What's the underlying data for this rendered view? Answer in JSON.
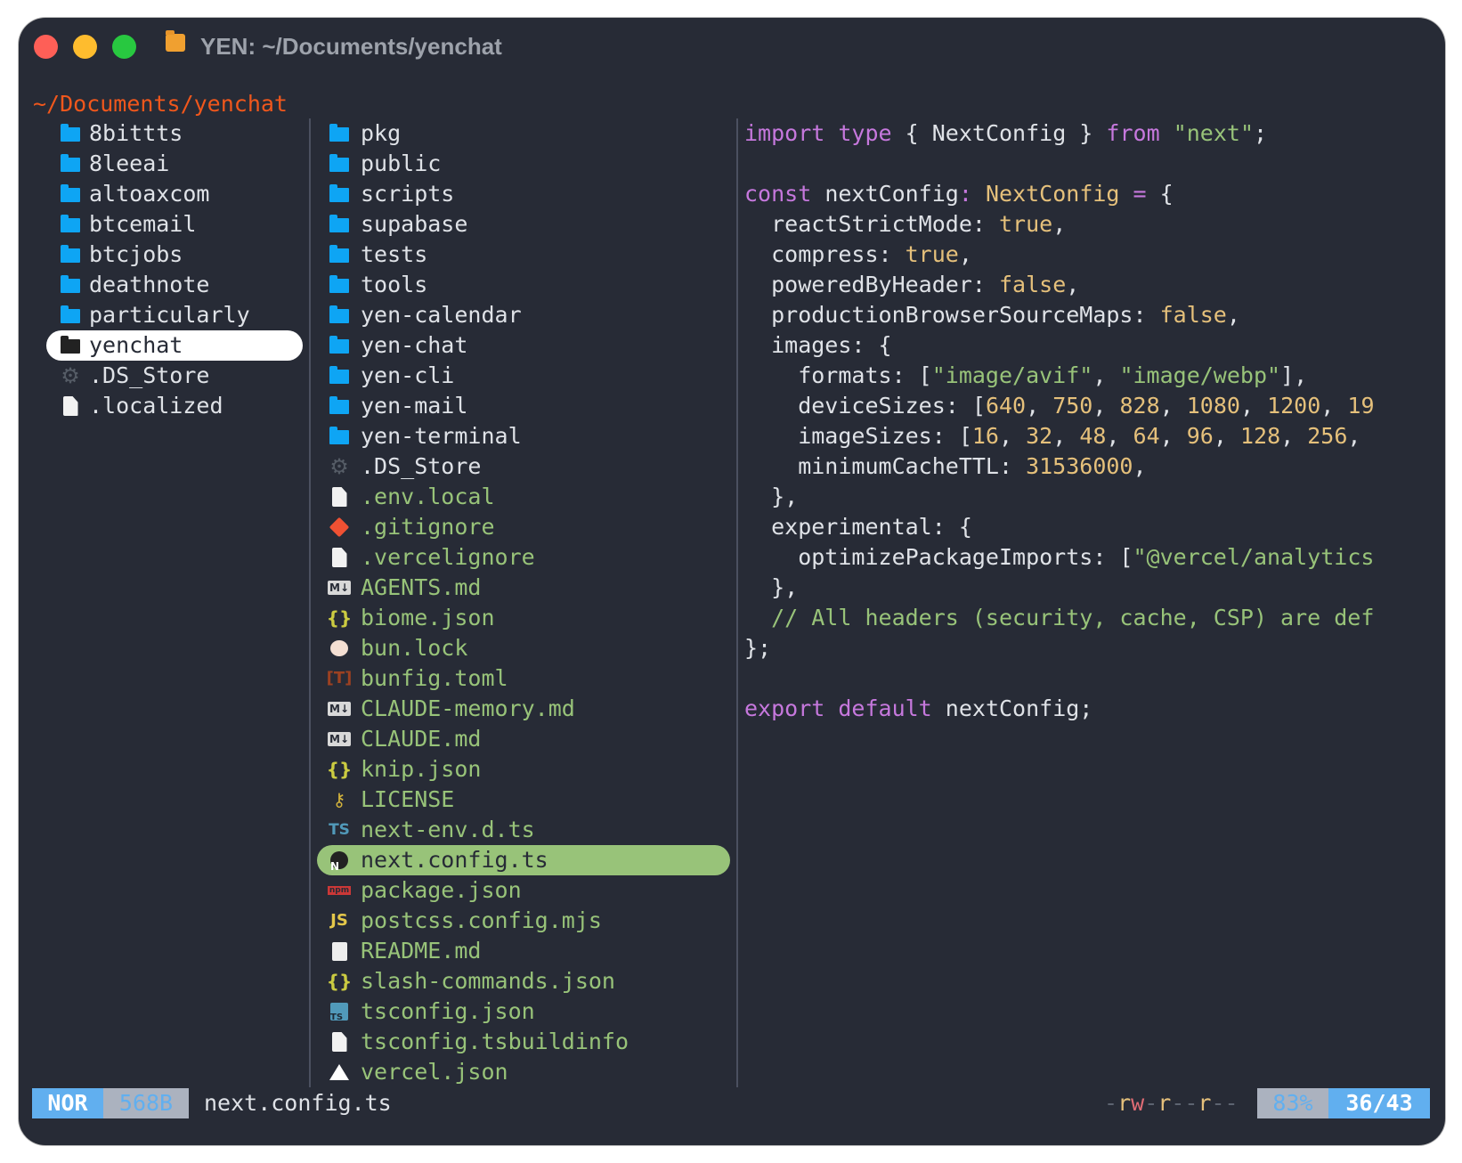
{
  "window": {
    "title": "YEN: ~/Documents/yenchat",
    "path": "~/Documents/yenchat"
  },
  "colors": {
    "accent_blue": "#61afef",
    "selection_green": "#98c379",
    "path_orange": "#f0571c"
  },
  "parent_column": [
    {
      "name": "8bittts",
      "icon": "folder"
    },
    {
      "name": "8leeai",
      "icon": "folder"
    },
    {
      "name": "altoaxcom",
      "icon": "folder"
    },
    {
      "name": "btcemail",
      "icon": "folder"
    },
    {
      "name": "btcjobs",
      "icon": "folder"
    },
    {
      "name": "deathnote",
      "icon": "folder"
    },
    {
      "name": "particularly",
      "icon": "folder"
    },
    {
      "name": "yenchat",
      "icon": "folder",
      "selected": true
    },
    {
      "name": ".DS_Store",
      "icon": "gear"
    },
    {
      "name": ".localized",
      "icon": "file"
    }
  ],
  "current_column": [
    {
      "name": "pkg",
      "icon": "folder"
    },
    {
      "name": "public",
      "icon": "folder"
    },
    {
      "name": "scripts",
      "icon": "folder"
    },
    {
      "name": "supabase",
      "icon": "folder"
    },
    {
      "name": "tests",
      "icon": "folder"
    },
    {
      "name": "tools",
      "icon": "folder"
    },
    {
      "name": "yen-calendar",
      "icon": "folder"
    },
    {
      "name": "yen-chat",
      "icon": "folder"
    },
    {
      "name": "yen-cli",
      "icon": "folder"
    },
    {
      "name": "yen-mail",
      "icon": "folder"
    },
    {
      "name": "yen-terminal",
      "icon": "folder"
    },
    {
      "name": ".DS_Store",
      "icon": "gear"
    },
    {
      "name": ".env.local",
      "icon": "file",
      "file": true
    },
    {
      "name": ".gitignore",
      "icon": "git",
      "file": true
    },
    {
      "name": ".vercelignore",
      "icon": "file",
      "file": true
    },
    {
      "name": "AGENTS.md",
      "icon": "md",
      "file": true
    },
    {
      "name": "biome.json",
      "icon": "json",
      "file": true
    },
    {
      "name": "bun.lock",
      "icon": "bun",
      "file": true
    },
    {
      "name": "bunfig.toml",
      "icon": "toml",
      "file": true
    },
    {
      "name": "CLAUDE-memory.md",
      "icon": "md",
      "file": true
    },
    {
      "name": "CLAUDE.md",
      "icon": "md",
      "file": true
    },
    {
      "name": "knip.json",
      "icon": "json",
      "file": true
    },
    {
      "name": "LICENSE",
      "icon": "license",
      "file": true
    },
    {
      "name": "next-env.d.ts",
      "icon": "ts",
      "file": true
    },
    {
      "name": "next.config.ts",
      "icon": "next",
      "file": true,
      "selected": true
    },
    {
      "name": "package.json",
      "icon": "npm",
      "file": true
    },
    {
      "name": "postcss.config.mjs",
      "icon": "js",
      "file": true
    },
    {
      "name": "README.md",
      "icon": "readme",
      "file": true
    },
    {
      "name": "slash-commands.json",
      "icon": "json",
      "file": true
    },
    {
      "name": "tsconfig.json",
      "icon": "tsconfig",
      "file": true
    },
    {
      "name": "tsconfig.tsbuildinfo",
      "icon": "file",
      "file": true
    },
    {
      "name": "vercel.json",
      "icon": "vercel",
      "file": true
    }
  ],
  "preview": [
    [
      [
        "import",
        "k"
      ],
      [
        " ",
        "p"
      ],
      [
        "type",
        "k"
      ],
      [
        " { NextConfig } ",
        "p"
      ],
      [
        "from",
        "k"
      ],
      [
        " ",
        "p"
      ],
      [
        "\"next\"",
        "s"
      ],
      [
        ";",
        "p"
      ]
    ],
    [],
    [
      [
        "const",
        "k"
      ],
      [
        " nextConfig",
        "p"
      ],
      [
        ":",
        "k"
      ],
      [
        " ",
        "p"
      ],
      [
        "NextConfig",
        "t"
      ],
      [
        " ",
        "p"
      ],
      [
        "=",
        "k"
      ],
      [
        " {",
        "p"
      ]
    ],
    [
      [
        "  reactStrictMode: ",
        "p"
      ],
      [
        "true",
        "n"
      ],
      [
        ",",
        "p"
      ]
    ],
    [
      [
        "  compress: ",
        "p"
      ],
      [
        "true",
        "n"
      ],
      [
        ",",
        "p"
      ]
    ],
    [
      [
        "  poweredByHeader: ",
        "p"
      ],
      [
        "false",
        "n"
      ],
      [
        ",",
        "p"
      ]
    ],
    [
      [
        "  productionBrowserSourceMaps: ",
        "p"
      ],
      [
        "false",
        "n"
      ],
      [
        ",",
        "p"
      ]
    ],
    [
      [
        "  images: {",
        "p"
      ]
    ],
    [
      [
        "    formats: [",
        "p"
      ],
      [
        "\"image/avif\"",
        "s"
      ],
      [
        ", ",
        "p"
      ],
      [
        "\"image/webp\"",
        "s"
      ],
      [
        "],",
        "p"
      ]
    ],
    [
      [
        "    deviceSizes: [",
        "p"
      ],
      [
        "640",
        "n"
      ],
      [
        ", ",
        "p"
      ],
      [
        "750",
        "n"
      ],
      [
        ", ",
        "p"
      ],
      [
        "828",
        "n"
      ],
      [
        ", ",
        "p"
      ],
      [
        "1080",
        "n"
      ],
      [
        ", ",
        "p"
      ],
      [
        "1200",
        "n"
      ],
      [
        ", ",
        "p"
      ],
      [
        "19",
        "n"
      ]
    ],
    [
      [
        "    imageSizes: [",
        "p"
      ],
      [
        "16",
        "n"
      ],
      [
        ", ",
        "p"
      ],
      [
        "32",
        "n"
      ],
      [
        ", ",
        "p"
      ],
      [
        "48",
        "n"
      ],
      [
        ", ",
        "p"
      ],
      [
        "64",
        "n"
      ],
      [
        ", ",
        "p"
      ],
      [
        "96",
        "n"
      ],
      [
        ", ",
        "p"
      ],
      [
        "128",
        "n"
      ],
      [
        ", ",
        "p"
      ],
      [
        "256",
        "n"
      ],
      [
        ",",
        "p"
      ]
    ],
    [
      [
        "    minimumCacheTTL: ",
        "p"
      ],
      [
        "31536000",
        "n"
      ],
      [
        ",",
        "p"
      ]
    ],
    [
      [
        "  },",
        "p"
      ]
    ],
    [
      [
        "  experimental: {",
        "p"
      ]
    ],
    [
      [
        "    optimizePackageImports: [",
        "p"
      ],
      [
        "\"@vercel/analytics",
        "s"
      ]
    ],
    [
      [
        "  },",
        "p"
      ]
    ],
    [
      [
        "  // All headers (security, cache, CSP) are def",
        "c"
      ]
    ],
    [
      [
        "};",
        "p"
      ]
    ],
    [],
    [
      [
        "export",
        "k"
      ],
      [
        " ",
        "p"
      ],
      [
        "default",
        "k"
      ],
      [
        " nextConfig;",
        "p"
      ]
    ]
  ],
  "statusbar": {
    "mode": "NOR",
    "size": "568B",
    "filename": "next.config.ts",
    "permissions": [
      [
        "-",
        "#5c6370"
      ],
      [
        "r",
        "#e5c07b"
      ],
      [
        "w",
        "#e06c75"
      ],
      [
        "-",
        "#5c6370"
      ],
      [
        "r",
        "#e5c07b"
      ],
      [
        "--",
        "#5c6370"
      ],
      [
        "r",
        "#e5c07b"
      ],
      [
        "--",
        "#5c6370"
      ]
    ],
    "percent": "83%",
    "position": "36/43"
  }
}
